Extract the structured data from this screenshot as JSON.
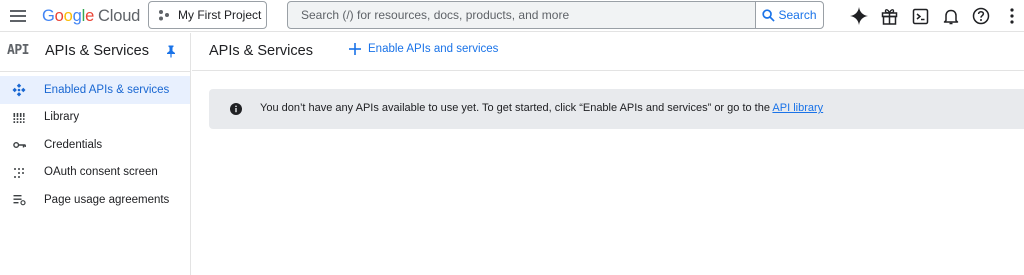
{
  "topbar": {
    "logo_google": [
      "G",
      "o",
      "o",
      "g",
      "l",
      "e"
    ],
    "logo_cloud": "Cloud",
    "project": "My First Project",
    "search_placeholder": "Search (/) for resources, docs, products, and more",
    "search_button": "Search",
    "icons": [
      "gemini-sparkle-icon",
      "gift-icon",
      "cloud-shell-icon",
      "notifications-bell-icon",
      "help-icon",
      "more-vert-icon"
    ]
  },
  "sidebar": {
    "logo": "API",
    "title": "APIs & Services",
    "items": [
      {
        "label": "Enabled APIs & services",
        "icon": "enabled-apis-icon",
        "active": true
      },
      {
        "label": "Library",
        "icon": "library-icon",
        "active": false
      },
      {
        "label": "Credentials",
        "icon": "key-icon",
        "active": false
      },
      {
        "label": "OAuth consent screen",
        "icon": "oauth-consent-icon",
        "active": false
      },
      {
        "label": "Page usage agreements",
        "icon": "page-usage-icon",
        "active": false
      }
    ]
  },
  "main": {
    "title": "APIs & Services",
    "enable_button": "Enable APIs and services",
    "banner": {
      "text": "You don’t have any APIs available to use yet. To get started, click “Enable APIs and services” or go to the ",
      "link": "API library"
    }
  },
  "colors": {
    "accent": "#1a73e8",
    "active_bg": "#e8f0fe",
    "banner_bg": "#e8eaed"
  }
}
